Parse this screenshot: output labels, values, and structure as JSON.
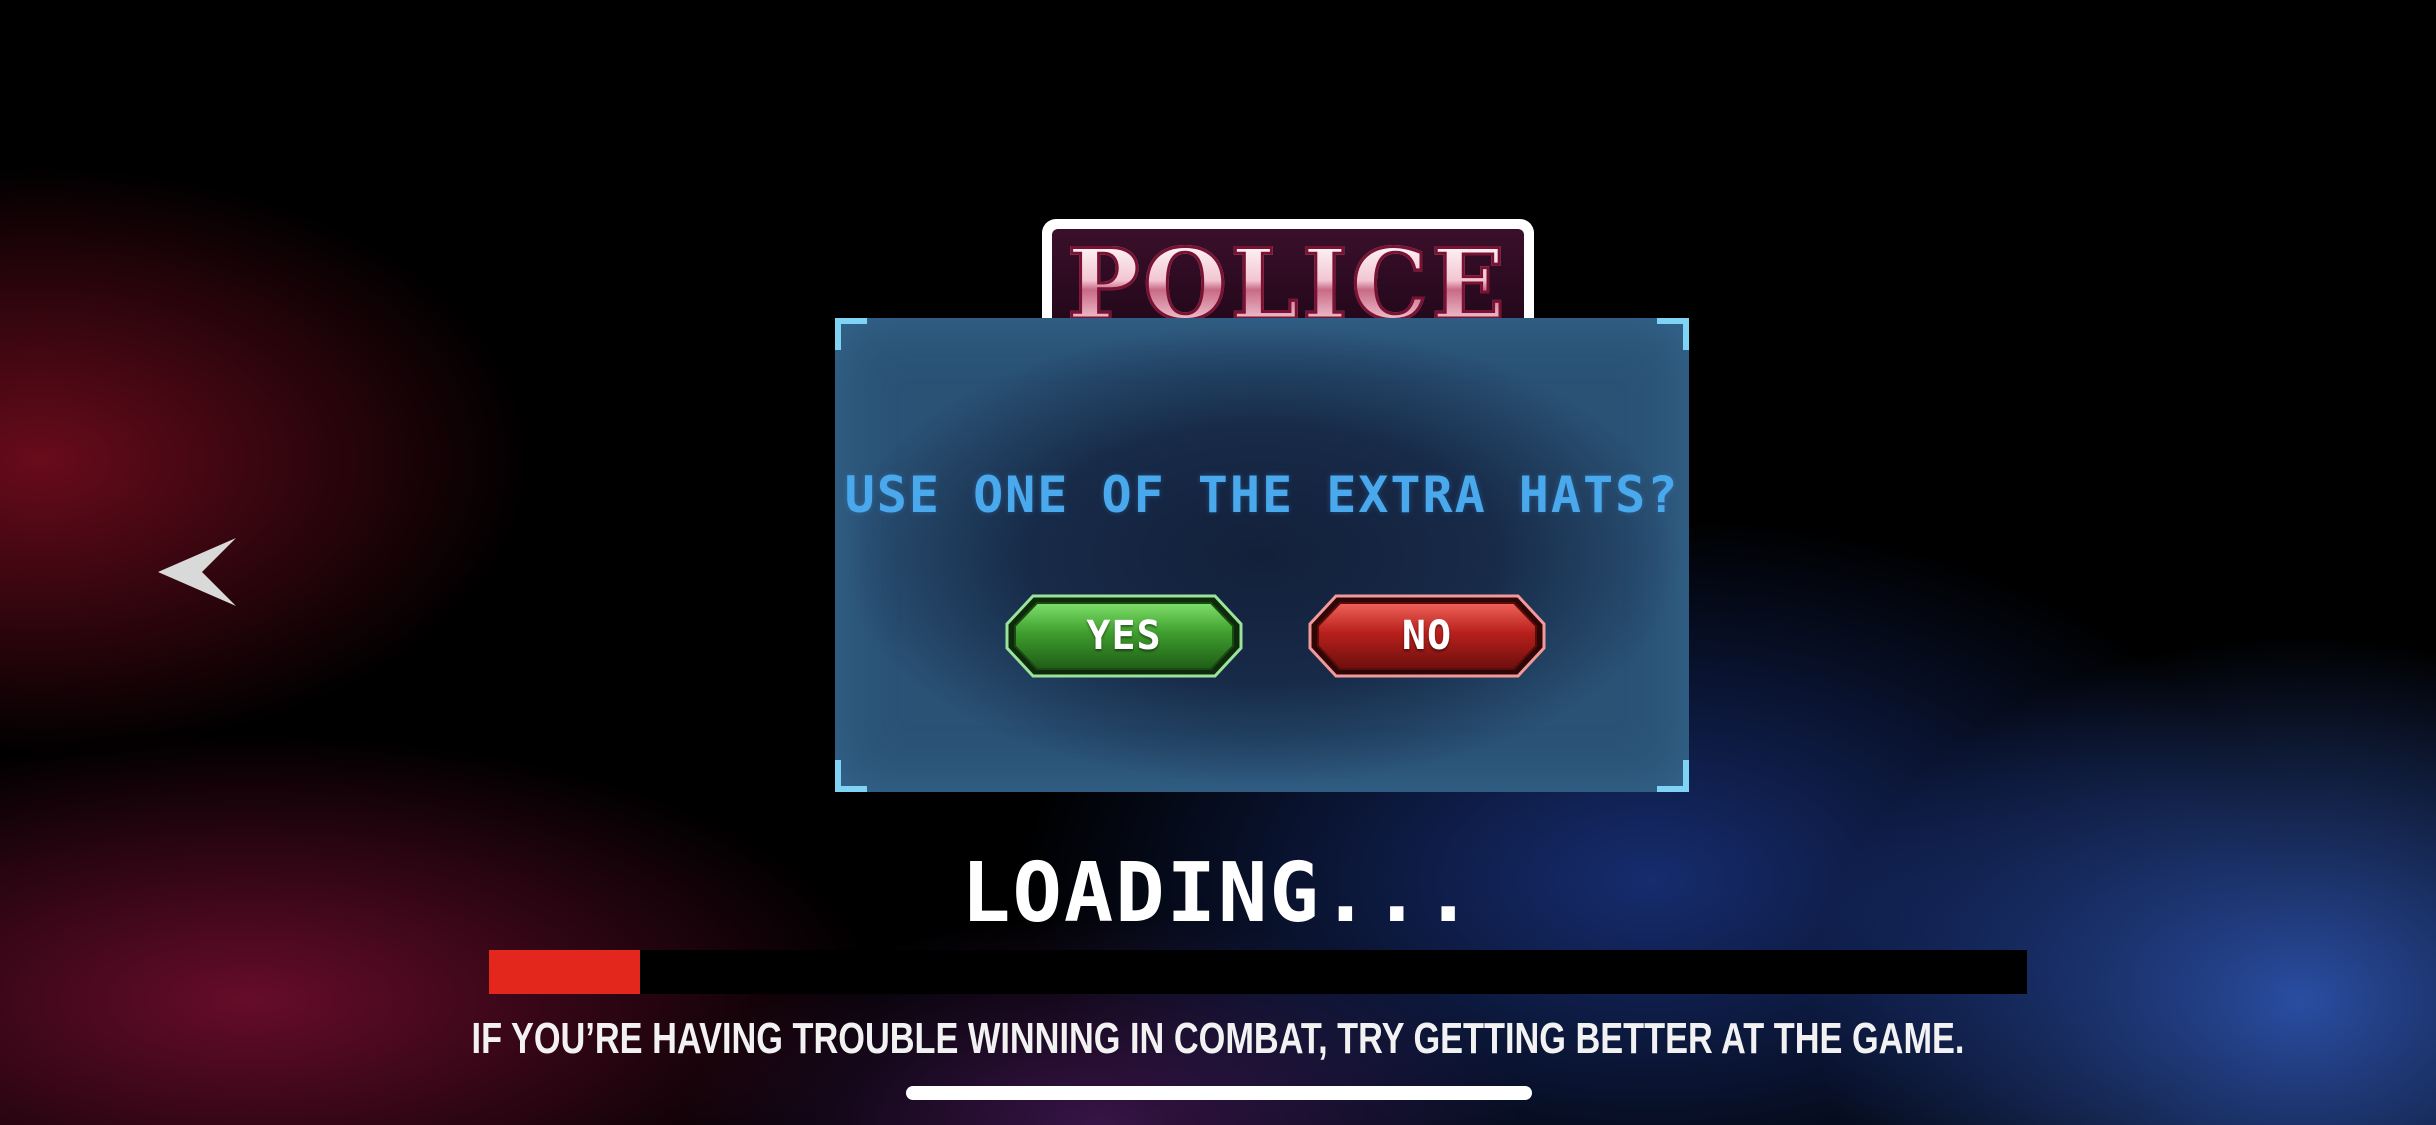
{
  "logo": {
    "text": "POLICE"
  },
  "dialog": {
    "question": "USE ONE OF THE EXTRA HATS?",
    "yes_label": "YES",
    "no_label": "NO",
    "yes_color": "#3e9a2c",
    "no_color": "#b21b1b",
    "accent_color": "#4aa8ec"
  },
  "loading": {
    "title": "LOADING...",
    "progress": 0.098,
    "progress_color": "#e3271d",
    "tip": "IF YOU’RE HAVING TROUBLE WINNING IN COMBAT, TRY GETTING BETTER AT THE GAME."
  },
  "icons": {
    "back": "back-arrow-icon"
  }
}
